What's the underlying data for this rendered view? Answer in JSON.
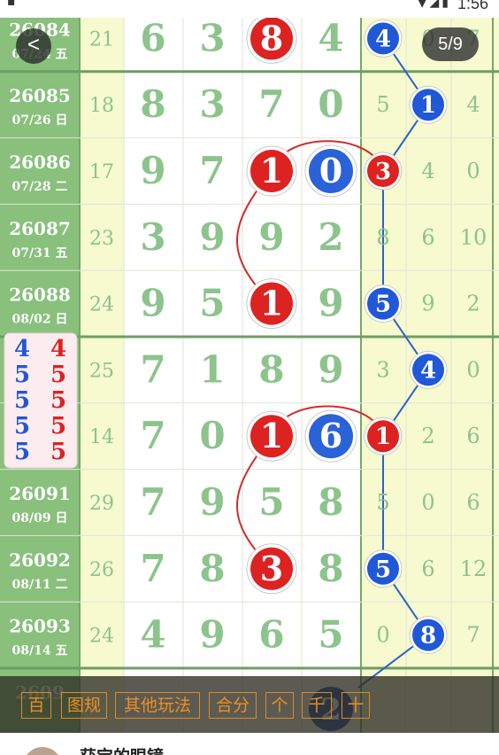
{
  "status_bar": {
    "time": "1:56",
    "left_icon": "sim-card-icon",
    "right_icons": "wifi signal battery"
  },
  "nav": {
    "back_label": "<",
    "page_indicator": "5/9"
  },
  "columns": {
    "ball_color": "#2058d8",
    "red_ball": "#dd2222",
    "num_color": "#8cc48c"
  },
  "rows": [
    {
      "issue": "26084",
      "date": "07/24 五",
      "sum": "21",
      "digits": [
        "6",
        "3",
        "8",
        "4"
      ],
      "right": [
        "4",
        "0",
        "7"
      ],
      "d_hl": 2,
      "d_ring": false,
      "r_hl": 0,
      "r_red": false
    },
    {
      "issue": "26085",
      "date": "07/26 日",
      "sum": "18",
      "digits": [
        "8",
        "3",
        "7",
        "0"
      ],
      "right": [
        "5",
        "1",
        "4"
      ],
      "d_hl": -1,
      "d_ring": false,
      "r_hl": 1,
      "r_red": false
    },
    {
      "issue": "26086",
      "date": "07/28 二",
      "sum": "17",
      "digits": [
        "9",
        "7",
        "1",
        "0"
      ],
      "right": [
        "3",
        "4",
        "0"
      ],
      "d_hl": 2,
      "d_ring": true,
      "r_hl": 0,
      "r_red": true
    },
    {
      "issue": "26087",
      "date": "07/31 五",
      "sum": "23",
      "digits": [
        "3",
        "9",
        "9",
        "2"
      ],
      "right": [
        "8",
        "6",
        "10"
      ],
      "d_hl": -1,
      "d_ring": false,
      "r_hl": -1,
      "r_red": false
    },
    {
      "issue": "26088",
      "date": "08/02 日",
      "sum": "24",
      "digits": [
        "9",
        "5",
        "1",
        "9"
      ],
      "right": [
        "5",
        "9",
        "2"
      ],
      "d_hl": 2,
      "d_ring": false,
      "r_hl": 0,
      "r_red": false
    },
    {
      "issue": "",
      "date": "",
      "sum": "25",
      "digits": [
        "7",
        "1",
        "8",
        "9"
      ],
      "right": [
        "3",
        "4",
        "0"
      ],
      "d_hl": -1,
      "d_ring": false,
      "r_hl": 1,
      "r_red": false
    },
    {
      "issue": "",
      "date": "",
      "sum": "14",
      "digits": [
        "7",
        "0",
        "1",
        "6"
      ],
      "right": [
        "1",
        "2",
        "6"
      ],
      "d_hl": 2,
      "d_ring": true,
      "r_hl": 0,
      "r_red": true
    },
    {
      "issue": "26091",
      "date": "08/09 日",
      "sum": "29",
      "digits": [
        "7",
        "9",
        "5",
        "8"
      ],
      "right": [
        "5",
        "0",
        "6"
      ],
      "d_hl": -1,
      "d_ring": false,
      "r_hl": -1,
      "r_red": false
    },
    {
      "issue": "26092",
      "date": "08/11 二",
      "sum": "26",
      "digits": [
        "7",
        "8",
        "3",
        "8"
      ],
      "right": [
        "5",
        "6",
        "12"
      ],
      "d_hl": 2,
      "d_ring": false,
      "r_hl": 0,
      "r_red": false
    },
    {
      "issue": "26093",
      "date": "08/14 五",
      "sum": "24",
      "digits": [
        "4",
        "9",
        "6",
        "5"
      ],
      "right": [
        "0",
        "8",
        "7"
      ],
      "d_hl": -1,
      "d_ring": false,
      "r_hl": 1,
      "r_red": false
    },
    {
      "issue": "2609",
      "date": "",
      "sum": "",
      "digits": [
        "",
        "",
        "",
        ""
      ],
      "right": [
        "",
        "",
        ""
      ],
      "d_hl": -1,
      "d_ring": false,
      "r_hl": -1,
      "r_red": false
    }
  ],
  "popup": {
    "rows": [
      [
        "4",
        "4"
      ],
      [
        "5",
        "5"
      ],
      [
        "5",
        "5"
      ],
      [
        "5",
        "5"
      ],
      [
        "5",
        "5"
      ]
    ]
  },
  "toolbar": {
    "buttons": [
      "百",
      "图规",
      "其他玩法",
      "合分",
      "个",
      "千",
      "十"
    ]
  },
  "partial_ball": "2",
  "author": {
    "name": "获宝的眼镜"
  }
}
